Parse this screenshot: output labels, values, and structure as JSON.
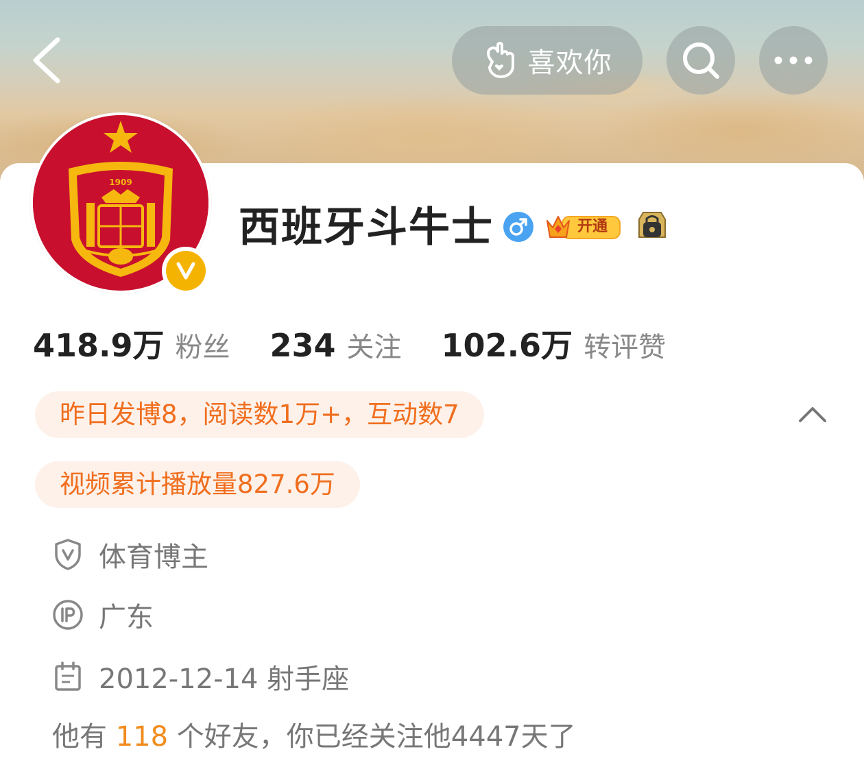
{
  "header": {
    "like_label": "喜欢你"
  },
  "profile": {
    "name": "西班牙斗牛士",
    "vip_label": "开通",
    "avatar_year": "1909"
  },
  "stats": [
    {
      "value": "418.9万",
      "label": "粉丝"
    },
    {
      "value": "234",
      "label": "关注"
    },
    {
      "value": "102.6万",
      "label": "转评赞"
    }
  ],
  "tags": {
    "activity": "昨日发博8，阅读数1万+，互动数7",
    "video": "视频累计播放量827.6万"
  },
  "info": {
    "category": "体育博主",
    "ip_location": "广东",
    "birthday": "2012-12-14 射手座"
  },
  "friends": {
    "prefix": "他有",
    "count": "118",
    "suffix": "个好友，你已经关注他4447天了"
  },
  "icons": {
    "back": "chevron-left-icon",
    "like": "hand-heart-icon",
    "search": "search-icon",
    "more": "more-dots-icon",
    "gender": "male-icon",
    "vip": "crown-icon",
    "lock": "lock-badge-icon",
    "verify": "verified-v-icon",
    "collapse": "chevron-up-icon",
    "category": "shield-v-icon",
    "ip": "ip-icon",
    "calendar": "calendar-icon"
  },
  "colors": {
    "accent_orange": "#f06e1e",
    "tag_bg": "#fdf1ea",
    "verify_gold": "#f5b301",
    "avatar_red": "#c8102e",
    "gender_blue": "#4aa3f0"
  }
}
